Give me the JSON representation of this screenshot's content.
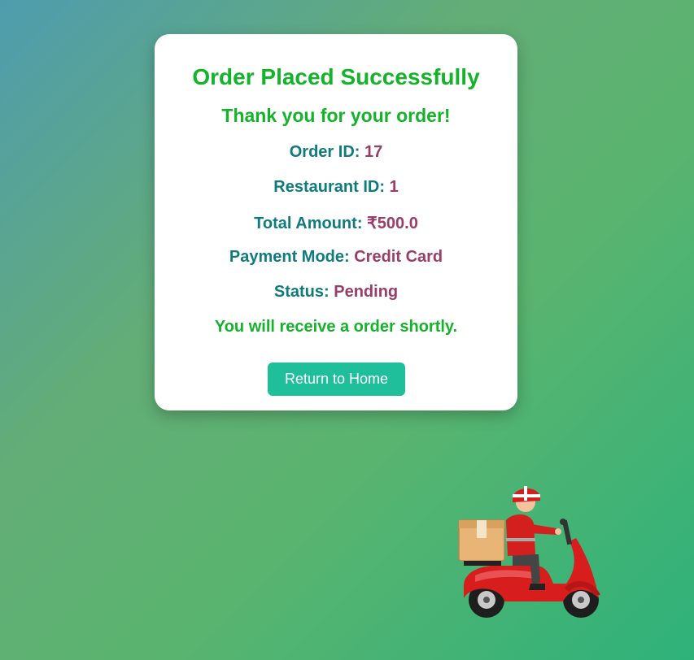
{
  "card": {
    "title": "Order Placed Successfully",
    "subtitle": "Thank you for your order!",
    "order_id_label": "Order ID:",
    "order_id_value": "17",
    "restaurant_id_label": "Restaurant ID:",
    "restaurant_id_value": "1",
    "total_amount_label": "Total Amount:",
    "total_amount_value": "₹500.0",
    "payment_mode_label": "Payment Mode:",
    "payment_mode_value": "Credit Card",
    "status_label": "Status:",
    "status_value": "Pending",
    "note": "You will receive a order shortly.",
    "home_button_label": "Return to Home"
  },
  "colors": {
    "heading_green": "#14b32a",
    "label_teal": "#0f7b7d",
    "value_maroon": "#993d6a",
    "button_teal": "#1fbf9b"
  },
  "illustration": {
    "icon": "delivery-scooter-icon"
  }
}
